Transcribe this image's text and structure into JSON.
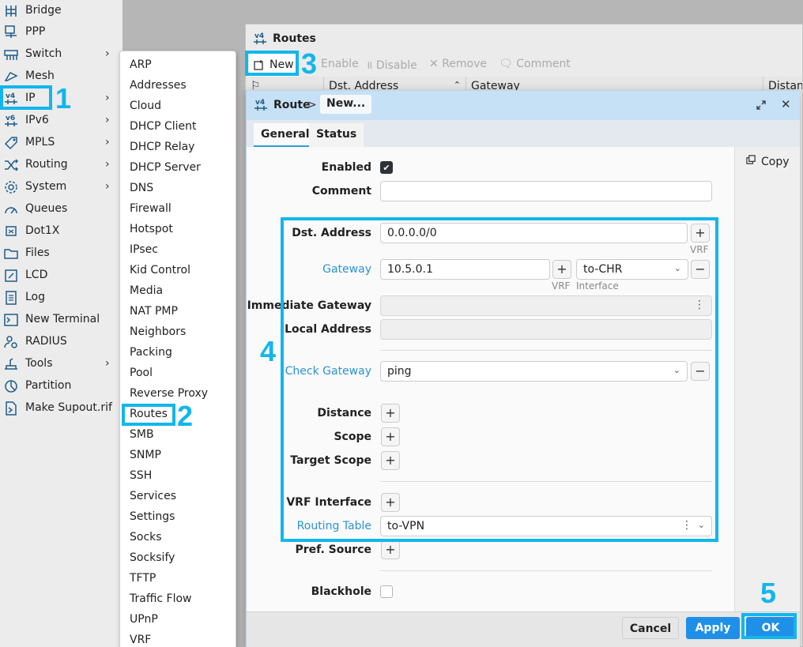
{
  "sidebar": {
    "items": [
      {
        "label": "Bridge",
        "icon": "bridge-icon",
        "chevron": ""
      },
      {
        "label": "PPP",
        "icon": "ppp-icon",
        "chevron": ""
      },
      {
        "label": "Switch",
        "icon": "switch-icon",
        "chevron": "›"
      },
      {
        "label": "Mesh",
        "icon": "mesh-icon",
        "chevron": ""
      },
      {
        "label": "IP",
        "icon": "ipv4-icon",
        "chevron": "›"
      },
      {
        "label": "IPv6",
        "icon": "ipv6-icon",
        "chevron": "›"
      },
      {
        "label": "MPLS",
        "icon": "mpls-icon",
        "chevron": "›"
      },
      {
        "label": "Routing",
        "icon": "routing-icon",
        "chevron": "›"
      },
      {
        "label": "System",
        "icon": "gear-icon",
        "chevron": "›"
      },
      {
        "label": "Queues",
        "icon": "queues-icon",
        "chevron": ""
      },
      {
        "label": "Dot1X",
        "icon": "dot1x-icon",
        "chevron": ""
      },
      {
        "label": "Files",
        "icon": "folder-icon",
        "chevron": ""
      },
      {
        "label": "LCD",
        "icon": "lcd-icon",
        "chevron": ""
      },
      {
        "label": "Log",
        "icon": "log-icon",
        "chevron": ""
      },
      {
        "label": "New Terminal",
        "icon": "terminal-icon",
        "chevron": ""
      },
      {
        "label": "RADIUS",
        "icon": "radius-icon",
        "chevron": ""
      },
      {
        "label": "Tools",
        "icon": "tools-icon",
        "chevron": "›"
      },
      {
        "label": "Partition",
        "icon": "partition-icon",
        "chevron": ""
      },
      {
        "label": "Make Supout.rif",
        "icon": "supout-icon",
        "chevron": ""
      }
    ]
  },
  "submenu": {
    "items": [
      "ARP",
      "Addresses",
      "Cloud",
      "DHCP Client",
      "DHCP Relay",
      "DHCP Server",
      "DNS",
      "Firewall",
      "Hotspot",
      "IPsec",
      "Kid Control",
      "Media",
      "NAT PMP",
      "Neighbors",
      "Packing",
      "Pool",
      "Reverse Proxy",
      "Routes",
      "SMB",
      "SNMP",
      "SSH",
      "Services",
      "Settings",
      "Socks",
      "Socksify",
      "TFTP",
      "Traffic Flow",
      "UPnP",
      "VRF"
    ]
  },
  "routes_window": {
    "icon_text": "v4",
    "title": "Routes",
    "toolbar": {
      "new": "New",
      "enable": "Enable",
      "disable": "Disable",
      "remove": "Remove",
      "comment": "Comment"
    },
    "columns": [
      "Dst. Address",
      "Gateway",
      "Distan"
    ]
  },
  "dialog": {
    "icon_text": "v4",
    "title": "Route",
    "separator": ">",
    "subtitle": "New...",
    "tabs": [
      "General",
      "Status"
    ],
    "copy_label": "Copy",
    "fields": {
      "enabled_label": "Enabled",
      "comment_label": "Comment",
      "comment_value": "",
      "dst_label": "Dst. Address",
      "dst_value": "0.0.0.0/0",
      "dst_sub": "VRF",
      "gateway_label": "Gateway",
      "gateway_value": "10.5.0.1",
      "gateway_iface": "to-CHR",
      "gateway_sub1": "VRF",
      "gateway_sub2": "Interface",
      "imm_label": "Immediate Gateway",
      "local_label": "Local Address",
      "check_label": "Check Gateway",
      "check_value": "ping",
      "distance_label": "Distance",
      "scope_label": "Scope",
      "target_label": "Target Scope",
      "vrf_label": "VRF Interface",
      "routing_label": "Routing Table",
      "routing_value": "to-VPN",
      "pref_label": "Pref. Source",
      "blackhole_label": "Blackhole"
    },
    "buttons": {
      "cancel": "Cancel",
      "apply": "Apply",
      "ok": "OK"
    }
  },
  "annotations": [
    "1",
    "2",
    "3",
    "4",
    "5"
  ],
  "colors": {
    "highlight": "#12b6ec",
    "accent": "#1e90e8",
    "link_blue": "#2a93d5"
  }
}
